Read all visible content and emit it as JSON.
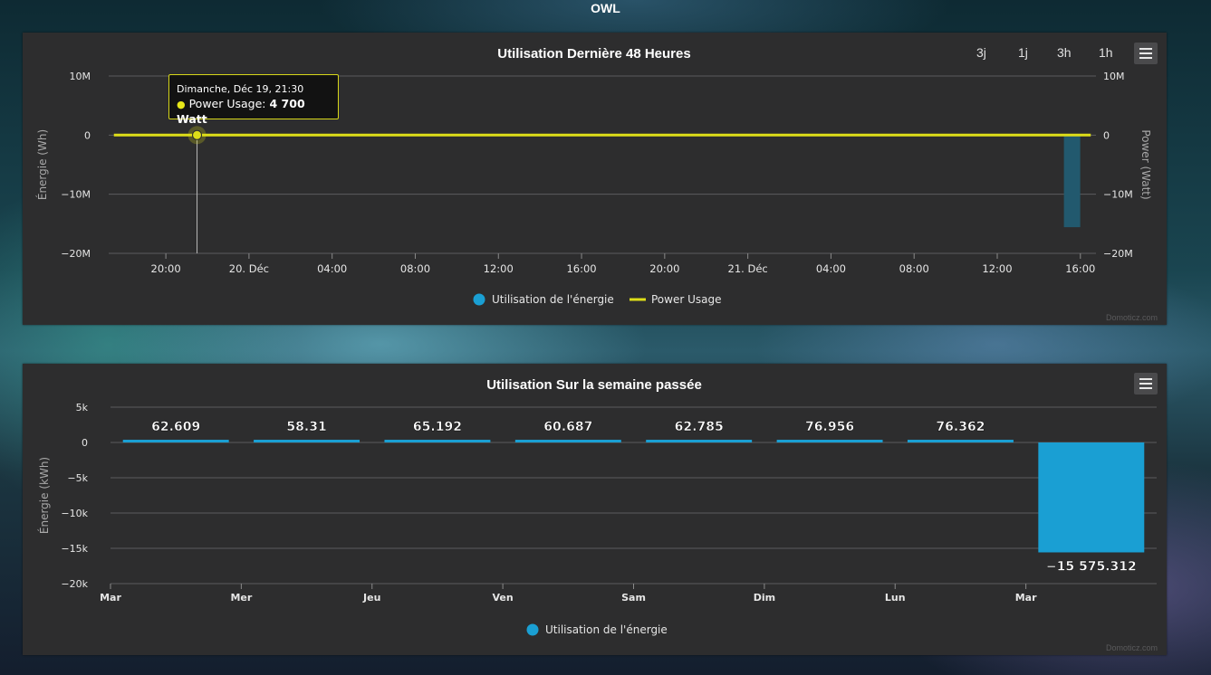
{
  "app": {
    "title": "OWL"
  },
  "colors": {
    "energy": "#1a9fd3",
    "power": "#dede18",
    "energy_neg": "#22596e",
    "panel_bg": "#2d2d2e"
  },
  "chart1": {
    "title": "Utilisation Dernière 48 Heures",
    "zoom_buttons": [
      "3j",
      "1j",
      "3h",
      "1h"
    ],
    "menu_icon": "hamburger-icon",
    "credits": "Domoticz.com",
    "tooltip": {
      "header": "Dimanche, Déc 19, 21:30",
      "series": "Power Usage: ",
      "value": "4 700 Watt"
    },
    "chart_data": {
      "type": "line",
      "title": "Utilisation Dernière 48 Heures",
      "x_tick_labels": [
        "20:00",
        "20. Déc",
        "04:00",
        "08:00",
        "12:00",
        "16:00",
        "20:00",
        "21. Déc",
        "04:00",
        "08:00",
        "12:00",
        "16:00"
      ],
      "x_ticks_hours": [
        20,
        24,
        28,
        32,
        36,
        40,
        44,
        48,
        52,
        56,
        60,
        64
      ],
      "xlim_hours": [
        17.25,
        64.75
      ],
      "y_left": {
        "label": "Énergie (Wh)",
        "ticks": [
          10000000,
          0,
          -10000000,
          -20000000
        ],
        "tick_labels": [
          "10M",
          "0",
          "−10M",
          "−20M"
        ],
        "range": [
          -20000000,
          10000000
        ]
      },
      "y_right": {
        "label": "Power (Watt)",
        "ticks": [
          10000000,
          0,
          -10000000,
          -20000000
        ],
        "tick_labels": [
          "10M",
          "0",
          "−10M",
          "−20M"
        ],
        "range": [
          -20000000,
          10000000
        ]
      },
      "legend": [
        "Utilisation de l'énergie",
        "Power Usage"
      ],
      "legend_position": "bottom",
      "series": [
        {
          "name": "Power Usage",
          "type": "line",
          "x_hours": [
            17.5,
            64.5
          ],
          "y": [
            4700,
            4700
          ],
          "highlight": {
            "x_hours": 21.5,
            "y": 4700
          }
        },
        {
          "name": "Utilisation de l'énergie",
          "type": "bar",
          "x_hours": [
            63.6
          ],
          "y": [
            -15575312
          ]
        }
      ],
      "grid": true
    }
  },
  "chart2": {
    "title": "Utilisation Sur la semaine passée",
    "menu_icon": "hamburger-icon",
    "credits": "Domoticz.com",
    "chart_data": {
      "type": "bar",
      "title": "Utilisation Sur la semaine passée",
      "categories": [
        "Mar",
        "Mer",
        "Jeu",
        "Ven",
        "Sam",
        "Dim",
        "Lun",
        "Mar"
      ],
      "ylabel": "Énergie (kWh)",
      "ylim": [
        -20000,
        5000
      ],
      "y_ticks": [
        5000,
        0,
        -5000,
        -10000,
        -15000,
        -20000
      ],
      "y_tick_labels": [
        "5k",
        "0",
        "−5k",
        "−10k",
        "−15k",
        "−20k"
      ],
      "series": [
        {
          "name": "Utilisation de l'énergie",
          "values": [
            62.609,
            58.31,
            65.192,
            60.687,
            62.785,
            76.956,
            76.362,
            -15575.312
          ],
          "data_labels": [
            "62.609",
            "58.31",
            "65.192",
            "60.687",
            "62.785",
            "76.956",
            "76.362",
            "−15 575.312"
          ]
        }
      ],
      "legend": [
        "Utilisation de l'énergie"
      ],
      "legend_position": "bottom",
      "grid": true
    }
  }
}
